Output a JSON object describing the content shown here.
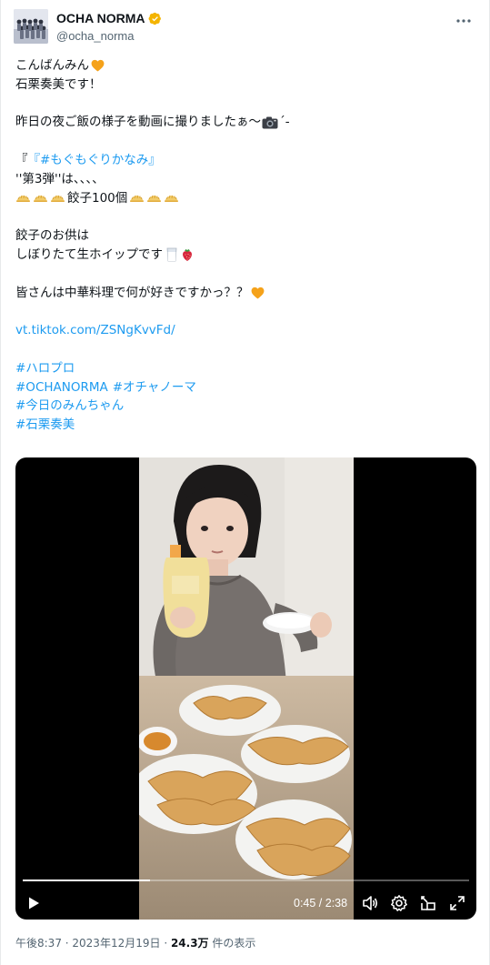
{
  "author": {
    "display_name": "OCHA NORMA",
    "handle": "@ocha_norma",
    "verified_color": "#f4b400"
  },
  "tweet": {
    "lines": {
      "l1": "こんばんみん",
      "l2": "石栗奏美です！",
      "l3": "昨日の夜ご飯の様子を動画に撮りましたぁ〜",
      "l3_tail": "´-",
      "l4": "『#もぐもぐりかなみ』",
      "l5": "''第3弾''は、、、、",
      "l6": "餃子100個",
      "l7": "餃子のお供は",
      "l8": "しぼりたて生ホイップです",
      "l9": "皆さんは中華料理で何が好きですかっ？？",
      "link": "vt.tiktok.com/ZSNgKvvFd/",
      "tag1": "#ハロプロ",
      "tag2": "#OCHANORMA",
      "tag3": "#オチャノーマ",
      "tag4": "#今日のみんちゃん",
      "tag5": "#石栗奏美"
    },
    "icons": {
      "heart": "orange-heart-icon",
      "camera": "camera-icon",
      "gyoza": "dumpling-icon",
      "milk": "glass-of-milk-icon",
      "strawberry": "strawberry-icon"
    },
    "link_color": "#1d9bf0"
  },
  "video": {
    "time": "0:45 / 2:38",
    "progress": 0.285
  },
  "meta": {
    "time": "午後8:37",
    "sep": " · ",
    "date": "2023年12月19日",
    "views_num": "24.3万",
    "views_label": "件の表示"
  }
}
